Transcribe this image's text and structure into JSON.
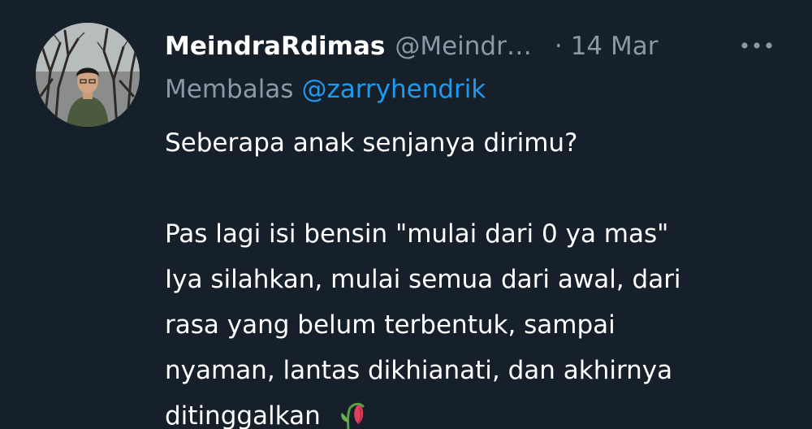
{
  "tweet": {
    "author": {
      "display_name": "MeindraRdimas",
      "handle": "@Meindr…",
      "avatar_icon": "profile-photo"
    },
    "separator": "·",
    "timestamp": "14 Mar",
    "more_icon": "more-horizontal-icon",
    "reply": {
      "prefix": "Membalas",
      "mention": "@zarryhendrik"
    },
    "body": {
      "line1": "Seberapa anak senjanya dirimu?",
      "line2": "Pas lagi isi bensin \"mulai dari 0 ya mas\"",
      "line3": "Iya silahkan, mulai semua dari awal, dari",
      "line4": "rasa yang belum terbentuk, sampai",
      "line5": "nyaman, lantas dikhianati, dan akhirnya",
      "line6": "ditinggalkan",
      "emoji": "wilted-flower-icon"
    }
  },
  "colors": {
    "background": "#15202b",
    "primary_text": "#ffffff",
    "secondary_text": "#8b98a5",
    "link": "#1d9bf0"
  }
}
